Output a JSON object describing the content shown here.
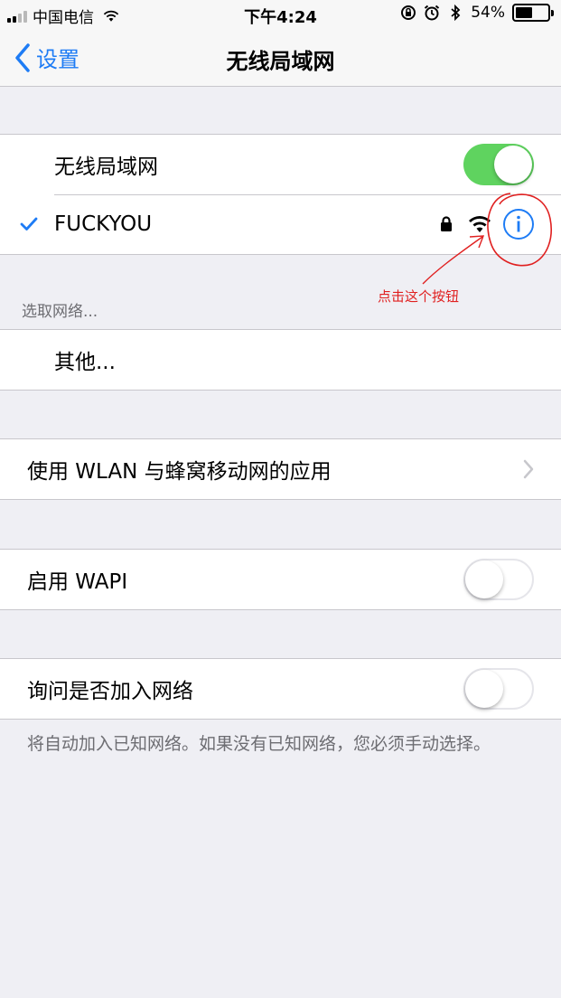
{
  "status_bar": {
    "carrier": "中国电信",
    "time": "下午4:24",
    "battery": "54%",
    "icons": [
      "signal-icon",
      "wifi-icon",
      "orientation-lock-icon",
      "alarm-icon",
      "bluetooth-icon",
      "battery-icon"
    ]
  },
  "nav": {
    "back_label": "设置",
    "title": "无线局域网"
  },
  "wifi_group": {
    "toggle_label": "无线局域网",
    "toggle_on": true,
    "connected_network": "FUCKYOU"
  },
  "choose_network": {
    "header": "选取网络...",
    "other_label": "其他..."
  },
  "wlan_apps": {
    "label": "使用 WLAN 与蜂窝移动网的应用"
  },
  "wapi": {
    "label": "启用 WAPI",
    "toggle_on": false
  },
  "ask_join": {
    "label": "询问是否加入网络",
    "toggle_on": false,
    "footnote": "将自动加入已知网络。如果没有已知网络，您必须手动选择。"
  },
  "annotation": {
    "text": "点击这个按钮"
  },
  "colors": {
    "accent": "#1e7cf5",
    "toggle_on": "#5fd35f",
    "background": "#efeff4",
    "annotation": "#e02020"
  }
}
